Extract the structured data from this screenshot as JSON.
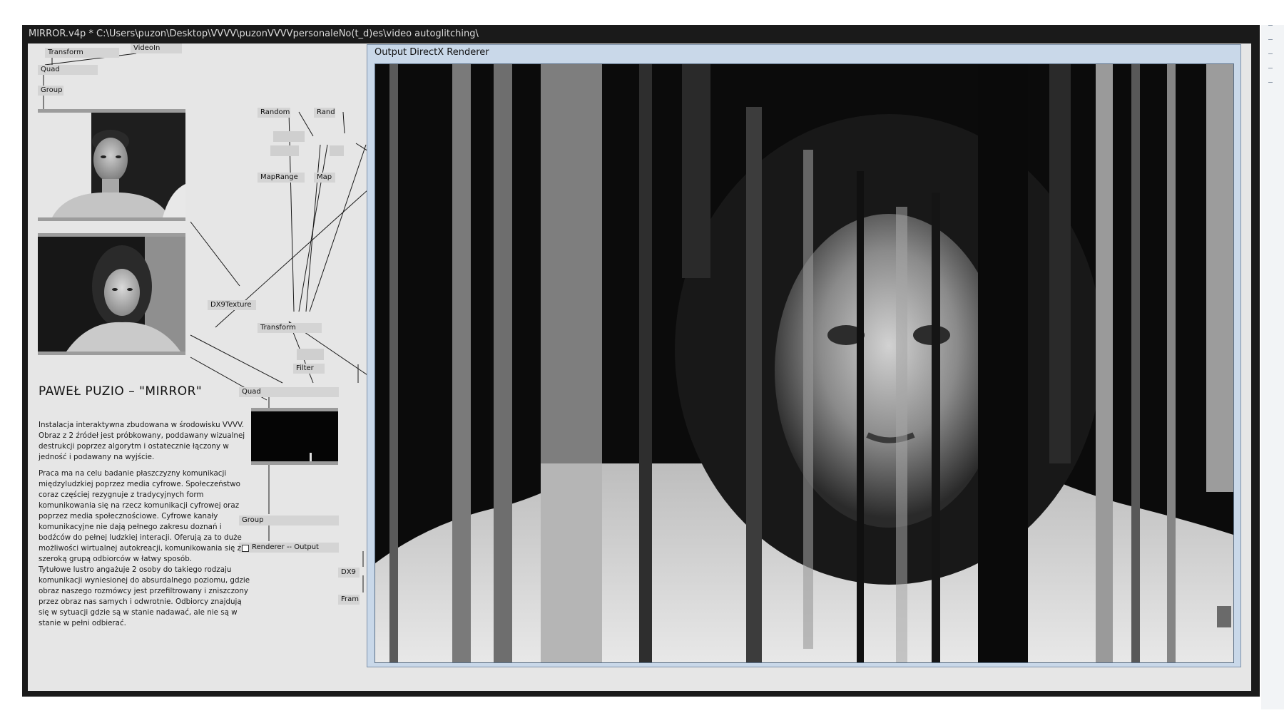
{
  "window": {
    "title": "MIRROR.v4p *  C:\\Users\\puzon\\Desktop\\VVVV\\puzonVVVVpersonaleNo(t_d)es\\video autoglitching\\"
  },
  "nodes": {
    "transform_top": "Transform",
    "videoin": "VideoIn",
    "quad_top": "Quad",
    "group_top": "Group",
    "random1": "Random",
    "random2": "Rand",
    "maprange1": "MapRange",
    "maprange2": "Map",
    "dx9texture": "DX9Texture",
    "transform_mid": "Transform",
    "filter": "Filter",
    "quad_mid": "Quad",
    "group_bottom": "Group",
    "renderer": "Renderer -- Output",
    "dx9_small": "DX9",
    "frame_small": "Fram"
  },
  "info": {
    "title": "PAWEŁ PUZIO  –  \"MIRROR\"",
    "paragraph1": "Instalacja interaktywna zbudowana w środowisku VVVV. Obraz z 2 źródeł jest próbkowany, poddawany wizualnej destrukcji poprzez algorytm i ostatecznie łączony w jedność i podawany na wyjście.",
    "paragraph2": "Praca ma na celu badanie płaszczyzny komunikacji międzyludzkiej poprzez media cyfrowe. Społeczeństwo coraz częściej rezygnuje z tradycyjnych form komunikowania się na rzecz komunikacji cyfrowej oraz poprzez media społecznościowe. Cyfrowe kanały komunikacyjne nie dają pełnego zakresu doznań i bodźców do pełnej ludzkiej interacji. Oferują za to duże możliwości wirtualnej autokreacji, komunikowania się z szeroką grupą odbiorców w łatwy sposób.",
    "paragraph3": "Tytułowe lustro angażuje 2 osoby do takiego rodzaju komunikacji wyniesionej do absurdalnego poziomu, gdzie obraz naszego rozmówcy jest przefiltrowany i zniszczony przez obraz nas samych i odwrotnie. Odbiorcy znajdują się w sytuacji gdzie są w stanie nadawać, ale nie są w stanie w pełni odbierać."
  },
  "output_window": {
    "title": "Output   DirectX Renderer"
  },
  "colors": {
    "patch_background": "#e6e6e6",
    "node_fill": "#d4d4d4",
    "output_frame": "#c9d8e9"
  }
}
